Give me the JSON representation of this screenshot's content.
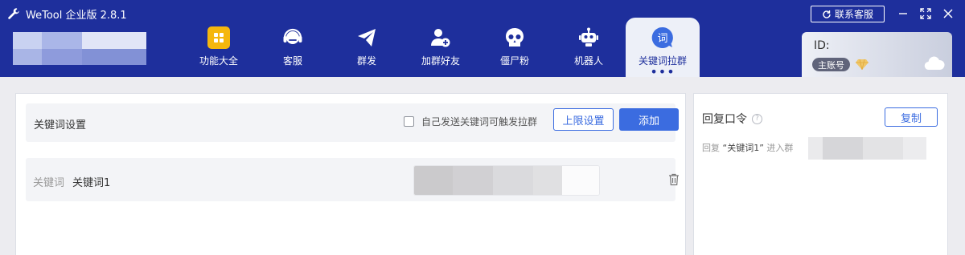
{
  "app": {
    "title": "WeTool 企业版 2.8.1"
  },
  "nav": [
    {
      "label": "功能大全",
      "icon": "grid-icon"
    },
    {
      "label": "客服",
      "icon": "headset-icon"
    },
    {
      "label": "群发",
      "icon": "paper-plane-icon"
    },
    {
      "label": "加群好友",
      "icon": "add-friend-icon"
    },
    {
      "label": "僵尸粉",
      "icon": "skull-icon"
    },
    {
      "label": "机器人",
      "icon": "robot-icon"
    },
    {
      "label": "关键词拉群",
      "icon": "keyword-bubble-icon",
      "active": true
    }
  ],
  "header": {
    "contact_label": "联系客服"
  },
  "account": {
    "id_label": "ID:",
    "badge": "主账号"
  },
  "settings": {
    "title": "关键词设置",
    "checkbox_label": "自己发送关键词可触发拉群",
    "checkbox_checked": false,
    "limit_button": "上限设置",
    "add_button": "添加"
  },
  "keyword_row": {
    "label": "关键词",
    "value": "关键词1"
  },
  "reply": {
    "title": "回复口令",
    "copy_button": "复制",
    "text_prefix": "回复",
    "keyword": "“关键词1”",
    "text_suffix": "进入群"
  },
  "colors": {
    "header_bg": "#1e2f9c",
    "accent": "#3b6ce0",
    "grid_icon": "#f5b70d"
  }
}
